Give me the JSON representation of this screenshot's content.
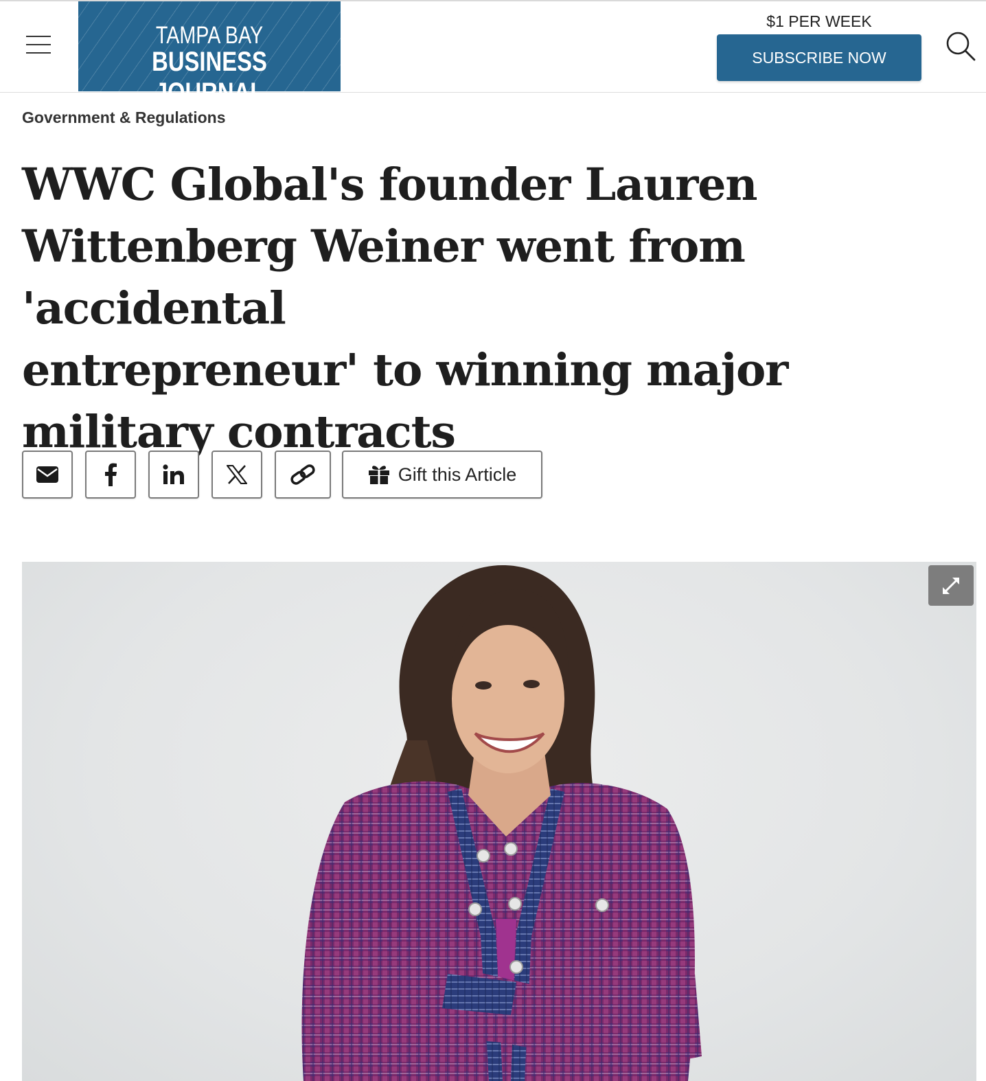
{
  "header": {
    "logo_line1": "TAMPA BAY",
    "logo_line2": "BUSINESS JOURNAL",
    "price": "$1 PER WEEK",
    "subscribe_label": "SUBSCRIBE NOW"
  },
  "article": {
    "section": "Government & Regulations",
    "headline_lines": [
      "WWC Global's founder Lauren",
      "Wittenberg Weiner went from 'accidental",
      "entrepreneur' to winning major",
      "military contracts"
    ]
  },
  "share": {
    "buttons": [
      "email-icon",
      "facebook-icon",
      "linkedin-icon",
      "x-icon",
      "link-icon"
    ],
    "gift_label": "Gift this Article"
  },
  "colors": {
    "brand_blue": "#266691",
    "expand_button": "#7d7d7d",
    "jacket_purple": "#7a2a6b",
    "jacket_navy": "#2a3f7a"
  }
}
